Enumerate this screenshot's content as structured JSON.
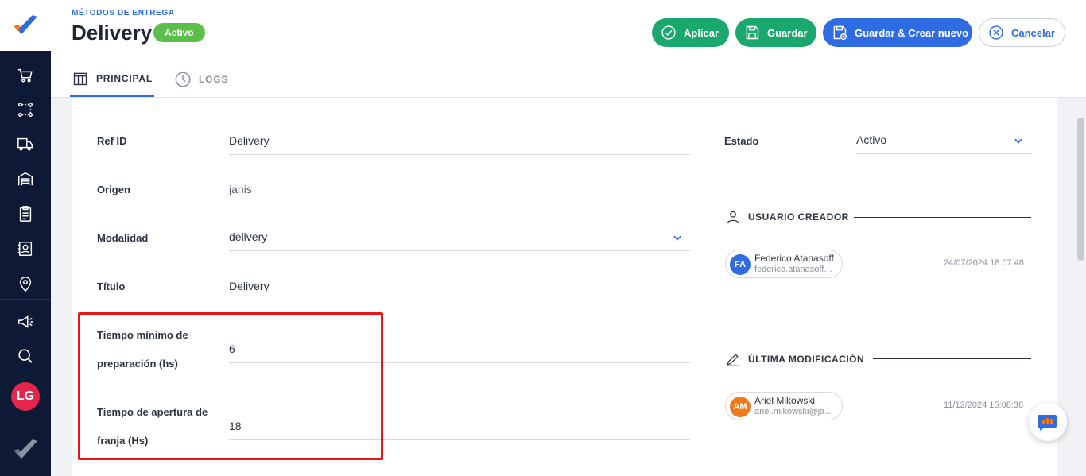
{
  "header": {
    "section": "MÉTODOS DE ENTREGA",
    "title": "Delivery",
    "status": "Activo"
  },
  "actions": {
    "apply": "Aplicar",
    "save": "Guardar",
    "save_new": "Guardar & Crear nuevo",
    "cancel": "Cancelar"
  },
  "tabs": [
    {
      "label": "PRINCIPAL",
      "active": true
    },
    {
      "label": "LOGS",
      "active": false
    }
  ],
  "fields": {
    "ref_id": {
      "label": "Ref ID",
      "value": "Delivery"
    },
    "origin": {
      "label": "Origen",
      "value": "janis"
    },
    "modality": {
      "label": "Modalidad",
      "value": "delivery"
    },
    "title": {
      "label": "Título",
      "value": "Delivery"
    },
    "min_prep": {
      "label_line1": "Tiempo mínimo de",
      "label_line2": "preparación (hs)",
      "value": "6"
    },
    "slot_open": {
      "label_line1": "Tiempo de apertura de",
      "label_line2": "franja (Hs)",
      "value": "18"
    },
    "state": {
      "label": "Estado",
      "value": "Activo"
    }
  },
  "creator": {
    "heading": "USUARIO CREADOR",
    "initials": "FA",
    "name": "Federico Atanasoff",
    "email": "federico.atanasoff@janis.im",
    "date": "24/07/2024 18:07:48",
    "avatar_color": "#2f6be3"
  },
  "modifier": {
    "heading": "ÚLTIMA MODIFICACIÓN",
    "initials": "AM",
    "name": "Ariel Mikowski",
    "email": "ariel.mikowski@janis.im",
    "date": "11/12/2024 15:08:36",
    "avatar_color": "#f07a1a"
  },
  "sidebar": {
    "user_initials": "LG",
    "icons": [
      "cart-icon",
      "route-icon",
      "truck-icon",
      "warehouse-icon",
      "clipboard-icon",
      "contacts-icon",
      "location-icon",
      "megaphone-icon",
      "search-icon"
    ]
  },
  "colors": {
    "primary": "#2f6be3",
    "success": "#1aa86f",
    "badge": "#5cbf4c",
    "sidebar": "#0e1a35",
    "highlight": "#e8151b"
  }
}
